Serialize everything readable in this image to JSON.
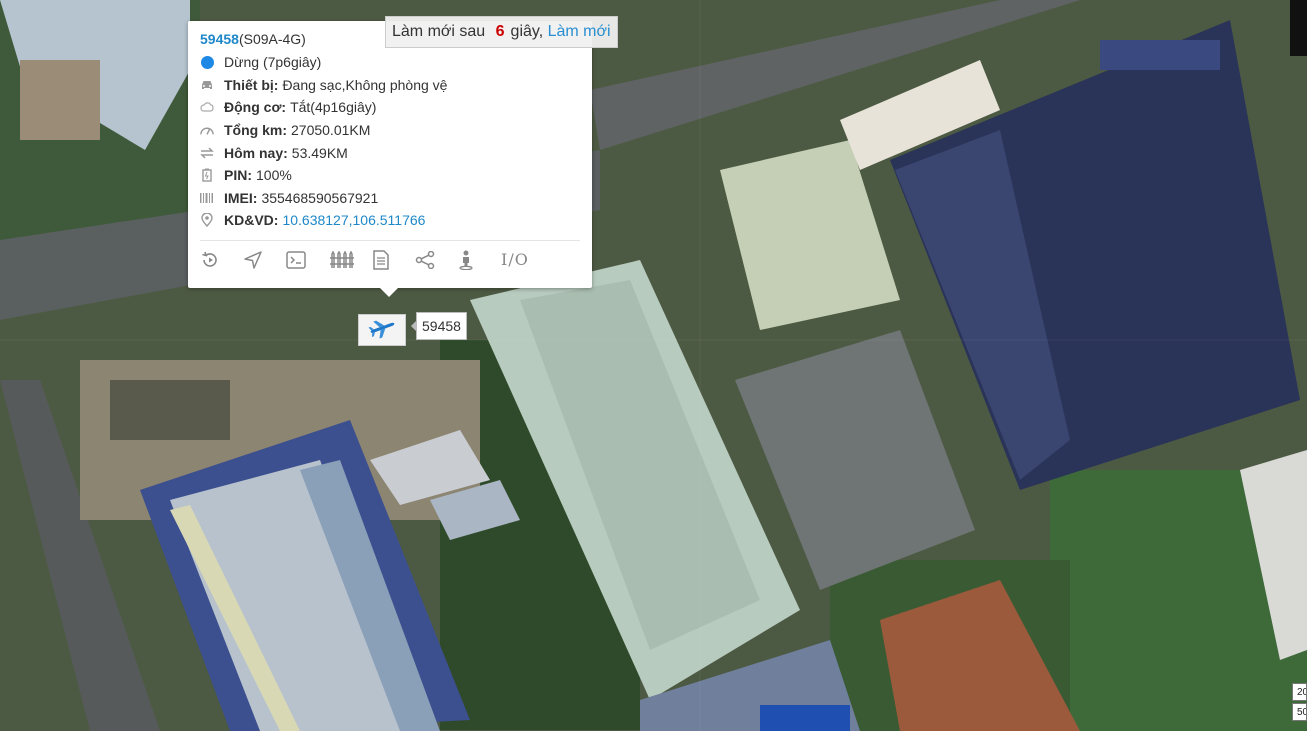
{
  "popup": {
    "vehicle_id": "59458",
    "device_model": "(S09A-4G)",
    "status": "Dừng (7p6giây)",
    "device_label": "Thiết bị:",
    "device_value": "Đang sạc,Không phòng vệ",
    "engine_label": "Động cơ:",
    "engine_value": "Tắt(4p16giây)",
    "total_km_label": "Tổng km:",
    "total_km_value": "27050.01KM",
    "today_label": "Hôm nay:",
    "today_value": "53.49KM",
    "pin_label": "PIN:",
    "pin_value": "100%",
    "imei_label": "IMEI:",
    "imei_value": "355468590567921",
    "coords_label": "KD&VD:",
    "coords_value": "10.638127,106.511766",
    "io_label": "I/O"
  },
  "refresh": {
    "prefix": "Làm mới sau",
    "seconds": "6",
    "suffix": "giây,",
    "link": "Làm mới"
  },
  "marker": {
    "label": "59458",
    "icon": "airplane-icon"
  },
  "scale": {
    "top": "20",
    "bottom": "50"
  },
  "colors": {
    "accent": "#1e88c8",
    "status_dot": "#1e88e5",
    "countdown": "#cc0000"
  }
}
